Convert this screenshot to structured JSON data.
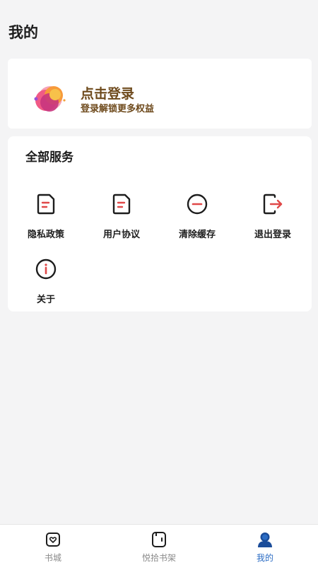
{
  "header": {
    "title": "我的"
  },
  "profile": {
    "login_title": "点击登录",
    "login_subtitle": "登录解锁更多权益",
    "brand_colors": [
      "#f45b8a",
      "#f79a3a",
      "#b83a8a"
    ]
  },
  "services": {
    "title": "全部服务",
    "items": [
      {
        "label": "隐私政策",
        "icon": "document-icon"
      },
      {
        "label": "用户协议",
        "icon": "document-icon"
      },
      {
        "label": "清除缓存",
        "icon": "minus-circle-icon"
      },
      {
        "label": "退出登录",
        "icon": "logout-icon"
      },
      {
        "label": "关于",
        "icon": "info-icon"
      }
    ]
  },
  "tabbar": {
    "active_color": "#2b6cc4",
    "tabs": [
      {
        "label": "书城",
        "icon": "bookstore-icon",
        "active": false
      },
      {
        "label": "悦拾书架",
        "icon": "bookshelf-icon",
        "active": false
      },
      {
        "label": "我的",
        "icon": "profile-icon",
        "active": true
      }
    ]
  }
}
